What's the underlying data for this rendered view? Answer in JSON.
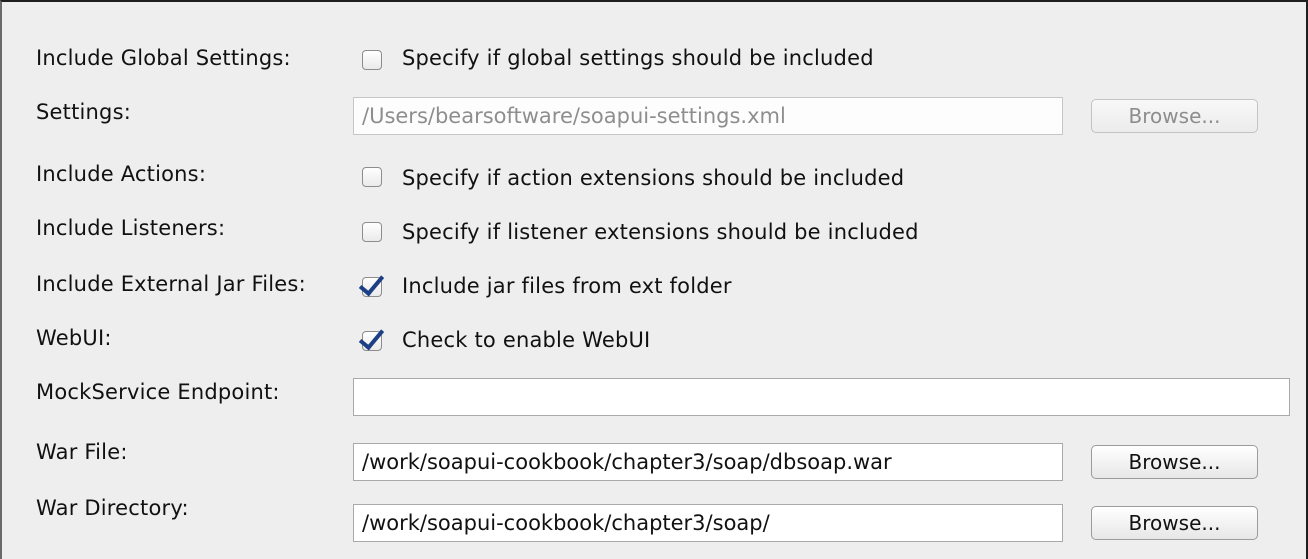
{
  "form": {
    "global_settings": {
      "label": "Include Global Settings:",
      "checkbox_text": "Specify if global settings should be included",
      "checked": false
    },
    "settings": {
      "label": "Settings:",
      "value": "/Users/bearsoftware/soapui-settings.xml",
      "browse_label": "Browse..."
    },
    "actions": {
      "label": "Include Actions:",
      "checkbox_text": "Specify if action extensions should be included",
      "checked": false
    },
    "listeners": {
      "label": "Include Listeners:",
      "checkbox_text": "Specify if listener extensions should be included",
      "checked": false
    },
    "external_jars": {
      "label": "Include External Jar Files:",
      "checkbox_text": "Include jar files from ext folder",
      "checked": true
    },
    "webui": {
      "label": "WebUI:",
      "checkbox_text": "Check to enable WebUI",
      "checked": true
    },
    "mockservice_endpoint": {
      "label": "MockService Endpoint:",
      "value": ""
    },
    "war_file": {
      "label": "War File:",
      "value": "/work/soapui-cookbook/chapter3/soap/dbsoap.war",
      "browse_label": "Browse..."
    },
    "war_directory": {
      "label": "War Directory:",
      "value": "/work/soapui-cookbook/chapter3/soap/",
      "browse_label": "Browse..."
    }
  }
}
